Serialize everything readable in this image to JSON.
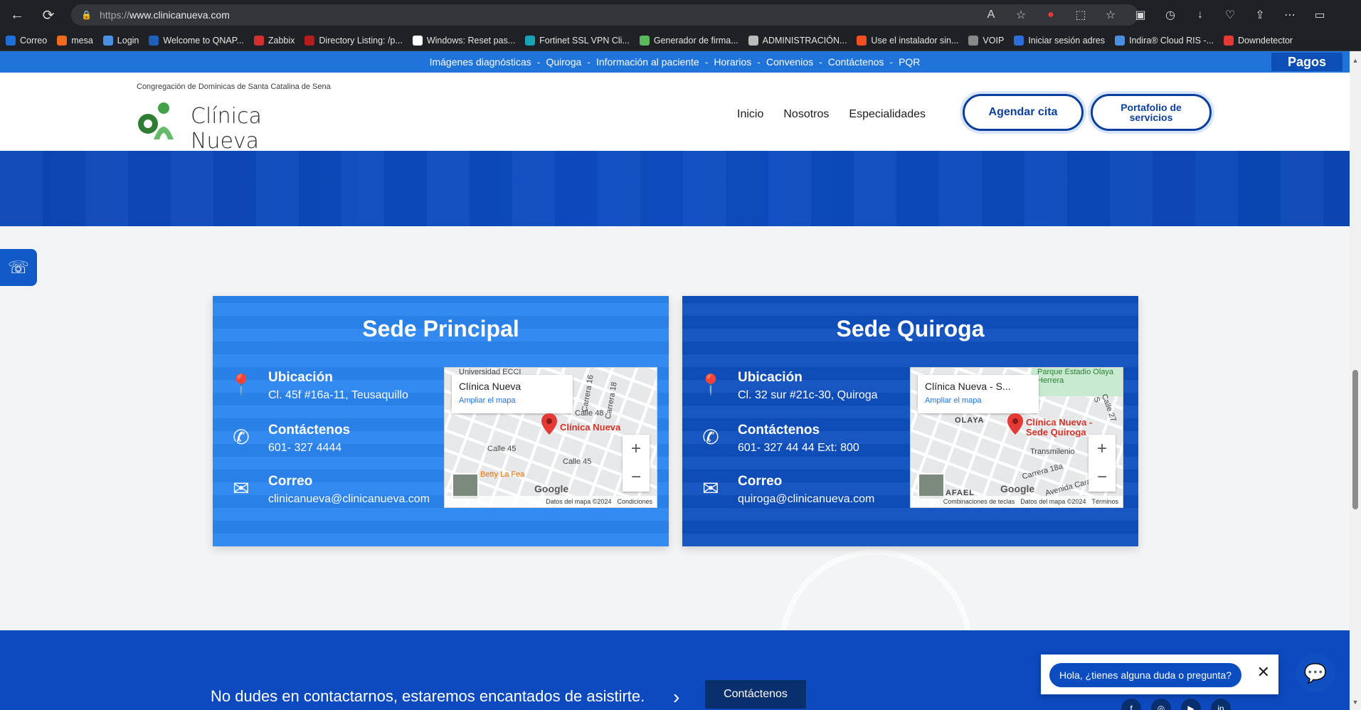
{
  "browser": {
    "url_proto": "https://",
    "url_host": "www.clinicanueva.com",
    "bookmarks": [
      {
        "label": "Correo",
        "color": "#1e6fd9"
      },
      {
        "label": "mesa",
        "color": "#f06a1d"
      },
      {
        "label": "Login",
        "color": "#4a90e2"
      },
      {
        "label": "Welcome to QNAP...",
        "color": "#1e5fb8"
      },
      {
        "label": "Zabbix",
        "color": "#d32f2f"
      },
      {
        "label": "Directory Listing: /p...",
        "color": "#b71c1c"
      },
      {
        "label": "Windows: Reset pas...",
        "color": "#ffffff"
      },
      {
        "label": "Fortinet SSL VPN Cli...",
        "color": "#17a2b8"
      },
      {
        "label": "Generador de firma...",
        "color": "#5cb85c"
      },
      {
        "label": "ADMINISTRACIÓN...",
        "color": "#bbbbbb"
      },
      {
        "label": "Use el instalador sin...",
        "color": "#f25022"
      },
      {
        "label": "VOIP",
        "color": "#888888"
      },
      {
        "label": "Iniciar sesión adres",
        "color": "#2a6fdb"
      },
      {
        "label": "Indira® Cloud RIS -...",
        "color": "#4a90e2"
      },
      {
        "label": "Downdetector",
        "color": "#e53935"
      }
    ]
  },
  "site": {
    "topnav": [
      "Imágenes diagnósticas",
      "Quiroga",
      "Información al paciente",
      "Horarios",
      "Convenios",
      "Contáctenos",
      "PQR"
    ],
    "pagos": "Pagos",
    "logo_caption": "Congregación de Dominicas de Santa Catalina de Sena",
    "logo_text": "Clínica Nueva",
    "menu": [
      "Inicio",
      "Nosotros",
      "Especialidades"
    ],
    "cta_agendar": "Agendar cita",
    "cta_portafolio": "Portafolio de servicios"
  },
  "sedes": [
    {
      "title": "Sede Principal",
      "ubicacion_label": "Ubicación",
      "ubicacion": "Cl. 45f #16a-11, Teusaquillo",
      "contacto_label": "Contáctenos",
      "contacto": "601- 327 4444",
      "correo_label": "Correo",
      "correo": "clinicanueva@clinicanueva.com",
      "map_title": "Clínica Nueva",
      "map_link": "Ampliar el mapa",
      "map_pin_label": "Clínica Nueva",
      "map_footer": [
        "Datos del mapa ©2024",
        "Condiciones"
      ]
    },
    {
      "title": "Sede Quiroga",
      "ubicacion_label": "Ubicación",
      "ubicacion": "Cl. 32 sur #21c-30, Quiroga",
      "contacto_label": "Contáctenos",
      "contacto": "601- 327 44 44 Ext: 800",
      "correo_label": "Correo",
      "correo": "quiroga@clinicanueva.com",
      "map_title": "Clínica Nueva - S...",
      "map_link": "Ampliar el mapa",
      "map_pin_label": "Clínica Nueva - Sede Quiroga",
      "map_footer": [
        "Combinaciones de teclas",
        "Datos del mapa ©2024",
        "Términos"
      ]
    }
  ],
  "map_labels": {
    "m1_streets": [
      "Calle 45",
      "Calle 45",
      "Calle 48",
      "Carrera 16",
      "Carrera 18",
      "Betty La Fea",
      "Universidad ECCI"
    ],
    "m2_streets": [
      "OLAYA",
      "Transmilenio",
      "RAFAEL",
      "Parque Estadio Olaya Herrera",
      "Calle 27 S",
      "Carrera 18a",
      "Avenida Caracas"
    ]
  },
  "bottom": {
    "text": "No dudes en contactarnos, estaremos encantados de asistirte.",
    "cta": "Contáctenos"
  },
  "chat": {
    "prompt": "Hola, ¿tienes alguna duda o pregunta?"
  }
}
